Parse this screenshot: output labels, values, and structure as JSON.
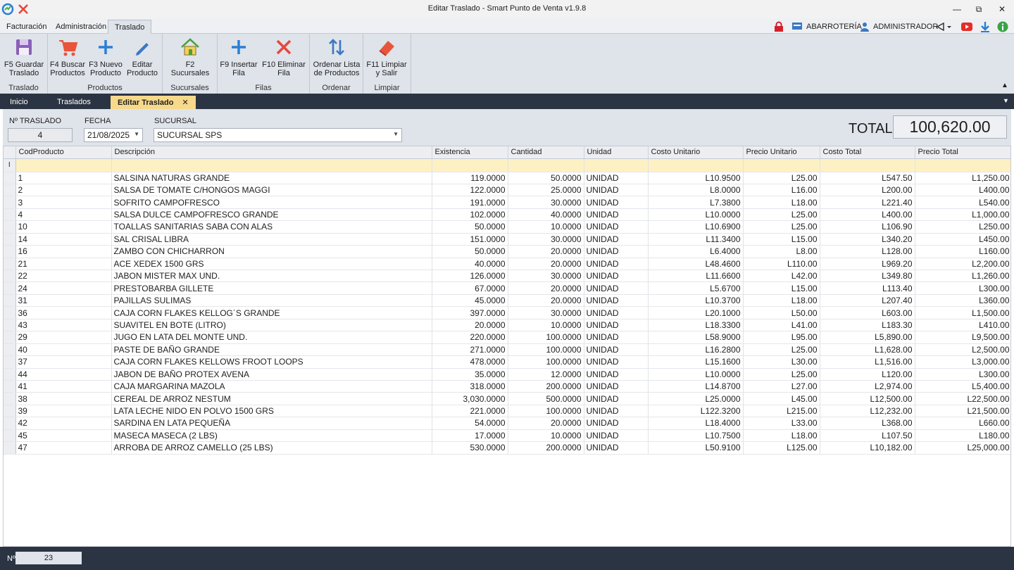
{
  "window": {
    "title": "Editar Traslado - Smart Punto de Venta v1.9.8"
  },
  "menu": {
    "tabs": [
      "Facturación",
      "Administración",
      "Traslado"
    ],
    "active": "Traslado"
  },
  "right_menu": {
    "store": "ABARROTERÍA",
    "user": "ADMINISTRADOR"
  },
  "ribbon": {
    "groups": [
      {
        "label": "Traslado",
        "buttons": [
          {
            "label": "F5 Guardar\nTraslado",
            "icon": "save-icon"
          }
        ]
      },
      {
        "label": "Productos",
        "buttons": [
          {
            "label": "F4 Buscar\nProductos",
            "icon": "cart-icon"
          },
          {
            "label": "F3 Nuevo\nProducto",
            "icon": "plus-icon"
          },
          {
            "label": "Editar\nProducto",
            "icon": "pencil-icon"
          }
        ]
      },
      {
        "label": "Sucursales",
        "buttons": [
          {
            "label": "F2 Sucursales",
            "icon": "house-icon"
          }
        ]
      },
      {
        "label": "Filas",
        "buttons": [
          {
            "label": "F9 Insertar\nFila",
            "icon": "plus-icon"
          },
          {
            "label": "F10 Eliminar\nFila",
            "icon": "x-icon"
          }
        ]
      },
      {
        "label": "Ordenar",
        "buttons": [
          {
            "label": "Ordenar Lista\nde Productos",
            "icon": "sort-icon"
          }
        ]
      },
      {
        "label": "Limpiar",
        "buttons": [
          {
            "label": "F11 Limpiar\ny Salir",
            "icon": "eraser-icon"
          }
        ]
      }
    ]
  },
  "doc_tabs": [
    "Inicio",
    "Traslados",
    "Editar Traslado"
  ],
  "form": {
    "num_label": "Nº TRASLADO",
    "num_value": "4",
    "fecha_label": "FECHA",
    "fecha_value": "21/08/2025",
    "sucursal_label": "SUCURSAL",
    "sucursal_value": "SUCURSAL SPS",
    "total_label": "TOTAL",
    "total_value": "100,620.00"
  },
  "grid": {
    "columns": [
      "CodProducto",
      "Descripción",
      "Existencia",
      "Cantidad",
      "Unidad",
      "Costo Unitario",
      "Precio Unitario",
      "Costo Total",
      "Precio Total"
    ],
    "new_row_marker": "I",
    "rows": [
      [
        "1",
        "SALSINA NATURAS GRANDE",
        "119.0000",
        "50.0000",
        "UNIDAD",
        "L10.9500",
        "L25.00",
        "L547.50",
        "L1,250.00"
      ],
      [
        "2",
        "SALSA DE TOMATE C/HONGOS MAGGI",
        "122.0000",
        "25.0000",
        "UNIDAD",
        "L8.0000",
        "L16.00",
        "L200.00",
        "L400.00"
      ],
      [
        "3",
        "SOFRITO CAMPOFRESCO",
        "191.0000",
        "30.0000",
        "UNIDAD",
        "L7.3800",
        "L18.00",
        "L221.40",
        "L540.00"
      ],
      [
        "4",
        "SALSA DULCE CAMPOFRESCO GRANDE",
        "102.0000",
        "40.0000",
        "UNIDAD",
        "L10.0000",
        "L25.00",
        "L400.00",
        "L1,000.00"
      ],
      [
        "10",
        "TOALLAS SANITARIAS SABA CON ALAS",
        "50.0000",
        "10.0000",
        "UNIDAD",
        "L10.6900",
        "L25.00",
        "L106.90",
        "L250.00"
      ],
      [
        "14",
        "SAL CRISAL LIBRA",
        "151.0000",
        "30.0000",
        "UNIDAD",
        "L11.3400",
        "L15.00",
        "L340.20",
        "L450.00"
      ],
      [
        "16",
        "ZAMBO CON CHICHARRON",
        "50.0000",
        "20.0000",
        "UNIDAD",
        "L6.4000",
        "L8.00",
        "L128.00",
        "L160.00"
      ],
      [
        "21",
        "ACE XEDEX 1500 GRS",
        "40.0000",
        "20.0000",
        "UNIDAD",
        "L48.4600",
        "L110.00",
        "L969.20",
        "L2,200.00"
      ],
      [
        "22",
        "JABON MISTER MAX UND.",
        "126.0000",
        "30.0000",
        "UNIDAD",
        "L11.6600",
        "L42.00",
        "L349.80",
        "L1,260.00"
      ],
      [
        "24",
        "PRESTOBARBA GILLETE",
        "67.0000",
        "20.0000",
        "UNIDAD",
        "L5.6700",
        "L15.00",
        "L113.40",
        "L300.00"
      ],
      [
        "31",
        "PAJILLAS SULIMAS",
        "45.0000",
        "20.0000",
        "UNIDAD",
        "L10.3700",
        "L18.00",
        "L207.40",
        "L360.00"
      ],
      [
        "36",
        "CAJA CORN FLAKES KELLOG´S GRANDE",
        "397.0000",
        "30.0000",
        "UNIDAD",
        "L20.1000",
        "L50.00",
        "L603.00",
        "L1,500.00"
      ],
      [
        "43",
        "SUAVITEL EN BOTE (LITRO)",
        "20.0000",
        "10.0000",
        "UNIDAD",
        "L18.3300",
        "L41.00",
        "L183.30",
        "L410.00"
      ],
      [
        "29",
        "JUGO EN LATA DEL MONTE UND.",
        "220.0000",
        "100.0000",
        "UNIDAD",
        "L58.9000",
        "L95.00",
        "L5,890.00",
        "L9,500.00"
      ],
      [
        "40",
        "PASTE DE BAÑO GRANDE",
        "271.0000",
        "100.0000",
        "UNIDAD",
        "L16.2800",
        "L25.00",
        "L1,628.00",
        "L2,500.00"
      ],
      [
        "37",
        "CAJA CORN FLAKES KELLOWS FROOT LOOPS",
        "478.0000",
        "100.0000",
        "UNIDAD",
        "L15.1600",
        "L30.00",
        "L1,516.00",
        "L3,000.00"
      ],
      [
        "44",
        "JABON DE BAÑO PROTEX AVENA",
        "35.0000",
        "12.0000",
        "UNIDAD",
        "L10.0000",
        "L25.00",
        "L120.00",
        "L300.00"
      ],
      [
        "41",
        "CAJA MARGARINA MAZOLA",
        "318.0000",
        "200.0000",
        "UNIDAD",
        "L14.8700",
        "L27.00",
        "L2,974.00",
        "L5,400.00"
      ],
      [
        "38",
        "CEREAL DE ARROZ NESTUM",
        "3,030.0000",
        "500.0000",
        "UNIDAD",
        "L25.0000",
        "L45.00",
        "L12,500.00",
        "L22,500.00"
      ],
      [
        "39",
        "LATA LECHE NIDO EN POLVO 1500 GRS",
        "221.0000",
        "100.0000",
        "UNIDAD",
        "L122.3200",
        "L215.00",
        "L12,232.00",
        "L21,500.00"
      ],
      [
        "42",
        "SARDINA EN LATA PEQUEÑA",
        "54.0000",
        "20.0000",
        "UNIDAD",
        "L18.4000",
        "L33.00",
        "L368.00",
        "L660.00"
      ],
      [
        "45",
        "MASECA MASECA (2 LBS)",
        "17.0000",
        "10.0000",
        "UNIDAD",
        "L10.7500",
        "L18.00",
        "L107.50",
        "L180.00"
      ],
      [
        "47",
        "ARROBA DE ARROZ CAMELLO (25 LBS)",
        "530.0000",
        "200.0000",
        "UNIDAD",
        "L50.9100",
        "L125.00",
        "L10,182.00",
        "L25,000.00"
      ]
    ]
  },
  "status": {
    "label": "Nº",
    "count": "23"
  },
  "colors": {
    "ribbon_bg": "#dfe3ea",
    "dark_bar": "#2b3442",
    "active_tab": "#f7d98b",
    "new_row": "#fdf1c4"
  }
}
